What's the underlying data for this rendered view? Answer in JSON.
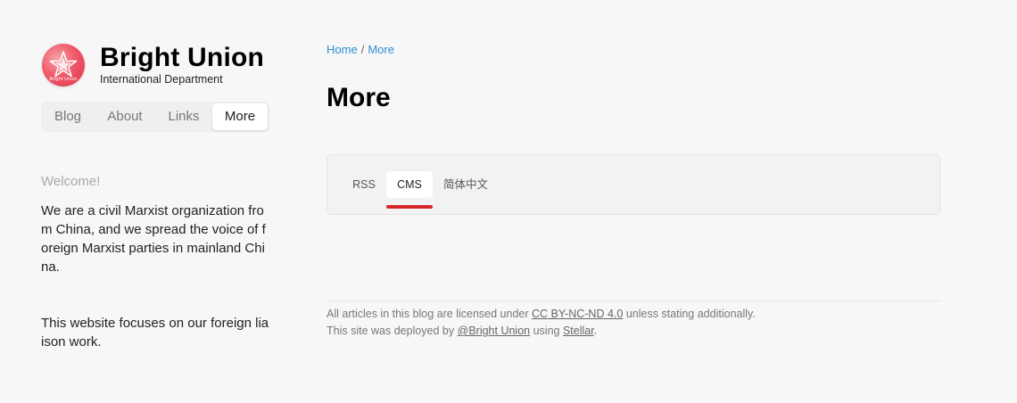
{
  "brand": {
    "name": "Bright Union",
    "subtitle": "International Department",
    "logo_text": "Bright Union"
  },
  "nav": {
    "items": [
      {
        "label": "Blog"
      },
      {
        "label": "About"
      },
      {
        "label": "Links"
      },
      {
        "label": "More"
      }
    ],
    "active": "More"
  },
  "sidebar": {
    "welcome_title": "Welcome!",
    "paragraph1": "We are a civil Marxist organization from China, and we spread the voice of foreign Marxist parties in mainland China.",
    "paragraph2": "This website focuses on our foreign liaison work."
  },
  "breadcrumb": {
    "home": "Home",
    "separator": "/",
    "current": "More"
  },
  "main": {
    "title": "More",
    "tabs": [
      {
        "label": "RSS"
      },
      {
        "label": "CMS"
      },
      {
        "label": "简体中文"
      }
    ],
    "active_tab": "CMS"
  },
  "footer": {
    "line1_prefix": "All articles in this blog are licensed under",
    "license_link": "CC BY-NC-ND 4.0",
    "line1_suffix": "unless stating additionally.",
    "line2_prefix": "This site was deployed by",
    "author_link": "@Bright Union",
    "line2_middle": "using",
    "theme_link": "Stellar",
    "line2_suffix": "."
  },
  "colors": {
    "background": "#f7f7f7",
    "link": "#2a8fd6",
    "tab_underline": "#d8262b",
    "logo": "#e8414f"
  },
  "icons": {
    "logo": "red-star-logo"
  }
}
